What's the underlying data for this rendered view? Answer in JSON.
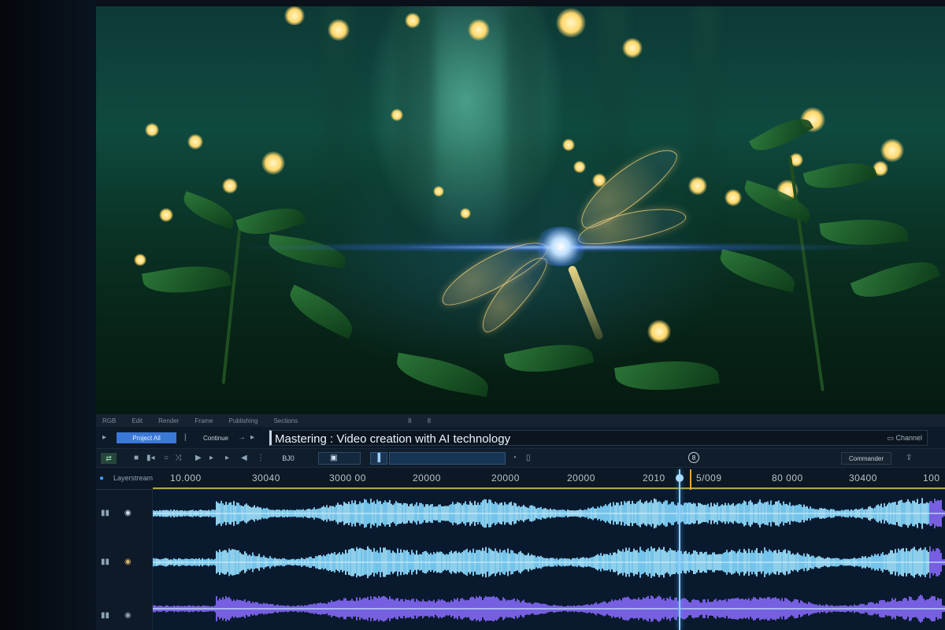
{
  "menu": [
    "RGB",
    "Edit",
    "Render",
    "Frame",
    "Publishing",
    "Sections"
  ],
  "menu_extra": [
    "8",
    "8"
  ],
  "toolbar": {
    "active_button": "Project All",
    "tool_label": "Continue",
    "title": "Mastering : Video creation with AI technology",
    "right_label": "Channel"
  },
  "toolbar2": {
    "field_label": "BJ0",
    "timecode_field": "",
    "search_field": "",
    "marker_badge": "8",
    "right_button": "Commander"
  },
  "ruler": {
    "track_label": "Layerstream",
    "ticks": [
      "10.000",
      "30040",
      "3000 00",
      "20000",
      "20000",
      "20000",
      "2010",
      "5/009",
      "80 000",
      "30400",
      "100"
    ]
  },
  "tracks": [
    {
      "name": "audio-track-1",
      "icon": "speaker-icon"
    },
    {
      "name": "audio-track-2",
      "icon": "speaker-icon"
    },
    {
      "name": "audio-track-3",
      "icon": "speaker-icon"
    }
  ],
  "colors": {
    "wave_primary": "#7fd6ff",
    "wave_secondary": "#4b8dff",
    "wave_purple": "#8a6cff",
    "playhead": "#8fd0ff",
    "marker": "#f2a33a",
    "active_button": "#3b79d8"
  }
}
